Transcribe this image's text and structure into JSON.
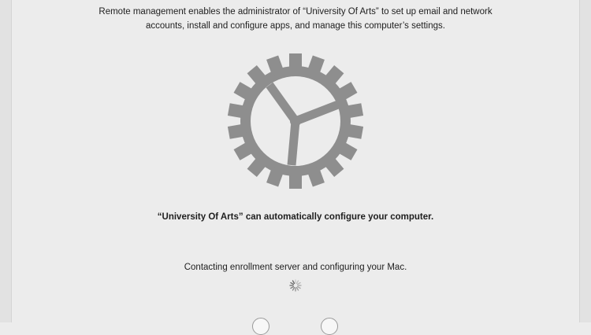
{
  "enrollment": {
    "intro_line1": "Remote management enables the administrator of “University Of Arts” to set up email and network",
    "intro_line2": "accounts, install and configure apps, and manage this computer’s settings.",
    "headline": "“University Of Arts” can automatically configure your computer.",
    "status": "Contacting enrollment server and configuring your Mac."
  },
  "icons": {
    "main": "gear-icon",
    "progress": "spinner-icon"
  },
  "colors": {
    "background": "#ececec",
    "gear": "#8e8e8e",
    "text": "#1e1e1e"
  }
}
